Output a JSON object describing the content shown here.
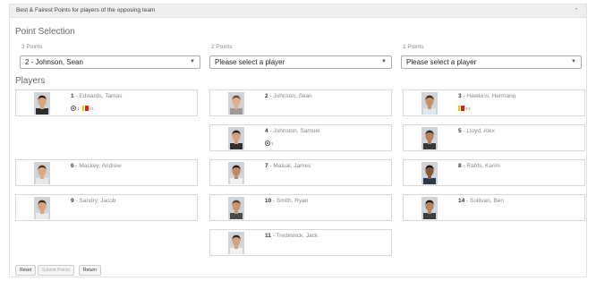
{
  "panel": {
    "title": "Best & Fairest Points for players of the opposing team"
  },
  "point_selection": {
    "heading": "Point Selection",
    "columns": [
      {
        "label": "3 Points",
        "value": "2 - Johnson, Sean"
      },
      {
        "label": "2 Points",
        "value": "Please select a player"
      },
      {
        "label": "1 Points",
        "value": "Please select a player"
      }
    ]
  },
  "players_heading": "Players",
  "players": [
    {
      "num": "1",
      "name": "- Edwards, Tamas",
      "goals": "1",
      "cards": "Y1"
    },
    {
      "num": "2",
      "name": "- Johnson, Sean"
    },
    {
      "num": "3",
      "name": "- Hawkins, Hermann",
      "cards": "Y1"
    },
    {
      "num": "4",
      "name": "- Johnston, Samuel",
      "goals": "1"
    },
    {
      "num": "5",
      "name": "- Lloyd, Alex"
    },
    {
      "num": "6",
      "name": "- Mackey, Andrew"
    },
    {
      "num": "7",
      "name": "- Malual, James"
    },
    {
      "num": "8",
      "name": "- Rahts, Karim"
    },
    {
      "num": "9",
      "name": "- Sandry, Jacob"
    },
    {
      "num": "10",
      "name": "- Smith, Ryan"
    },
    {
      "num": "14",
      "name": "- Sullivan, Ben"
    },
    {
      "num": "11",
      "name": "- Tredinnick, Jack"
    }
  ],
  "buttons": {
    "reset": "Reset",
    "submit": "Submit Points",
    "return": "Return"
  }
}
